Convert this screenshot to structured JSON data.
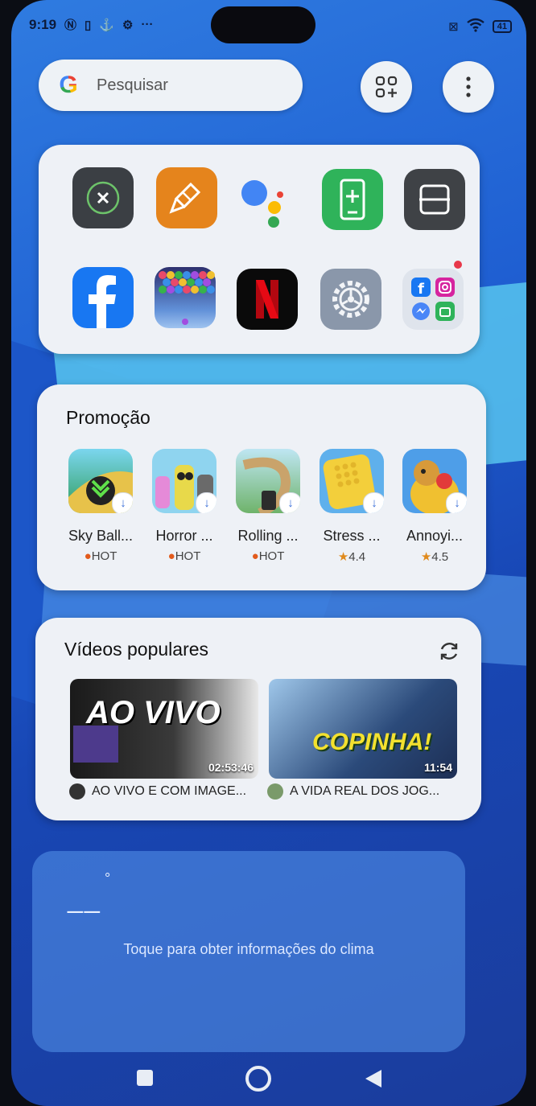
{
  "status_bar": {
    "time": "9:19",
    "battery": "41"
  },
  "search": {
    "placeholder": "Pesquisar"
  },
  "apps": {
    "row1": [
      {
        "icon": "close-app-icon",
        "bg": "#3b3f44"
      },
      {
        "icon": "cleaner-icon",
        "bg": "#e5841c"
      },
      {
        "icon": "google-assistant-icon",
        "bg": "transparent"
      },
      {
        "icon": "phone-manager-icon",
        "bg": "#2fb35a"
      },
      {
        "icon": "scanner-icon",
        "bg": "#3f4246"
      }
    ],
    "row2": [
      {
        "icon": "facebook-icon",
        "bg": "#1877f2"
      },
      {
        "icon": "bubble-shooter-icon",
        "bg": "#3f73c9"
      },
      {
        "icon": "netflix-icon",
        "bg": "#0a0a0a"
      },
      {
        "icon": "settings-icon",
        "bg": "#8a97aa"
      },
      {
        "icon": "social-folder-icon",
        "bg": "#dfe4ec"
      }
    ]
  },
  "promo": {
    "title": "Promoção",
    "items": [
      {
        "name": "Sky Ball...",
        "meta": "HOT",
        "type": "hot"
      },
      {
        "name": "Horror ...",
        "meta": "HOT",
        "type": "hot"
      },
      {
        "name": "Rolling ...",
        "meta": "HOT",
        "type": "hot"
      },
      {
        "name": "Stress ...",
        "meta": "4.4",
        "type": "rating"
      },
      {
        "name": "Annoyi...",
        "meta": "4.5",
        "type": "rating"
      }
    ]
  },
  "videos": {
    "title": "Vídeos populares",
    "items": [
      {
        "thumb_text": "AO VIVO",
        "duration": "02:53:46",
        "title": "AO VIVO E COM IMAGE..."
      },
      {
        "thumb_text": "COPINHA!",
        "duration": "11:54",
        "title": "A VIDA REAL DOS JOG..."
      }
    ]
  },
  "weather": {
    "temp": "__",
    "degree": "°",
    "text": "Toque para obter informações do clima"
  }
}
